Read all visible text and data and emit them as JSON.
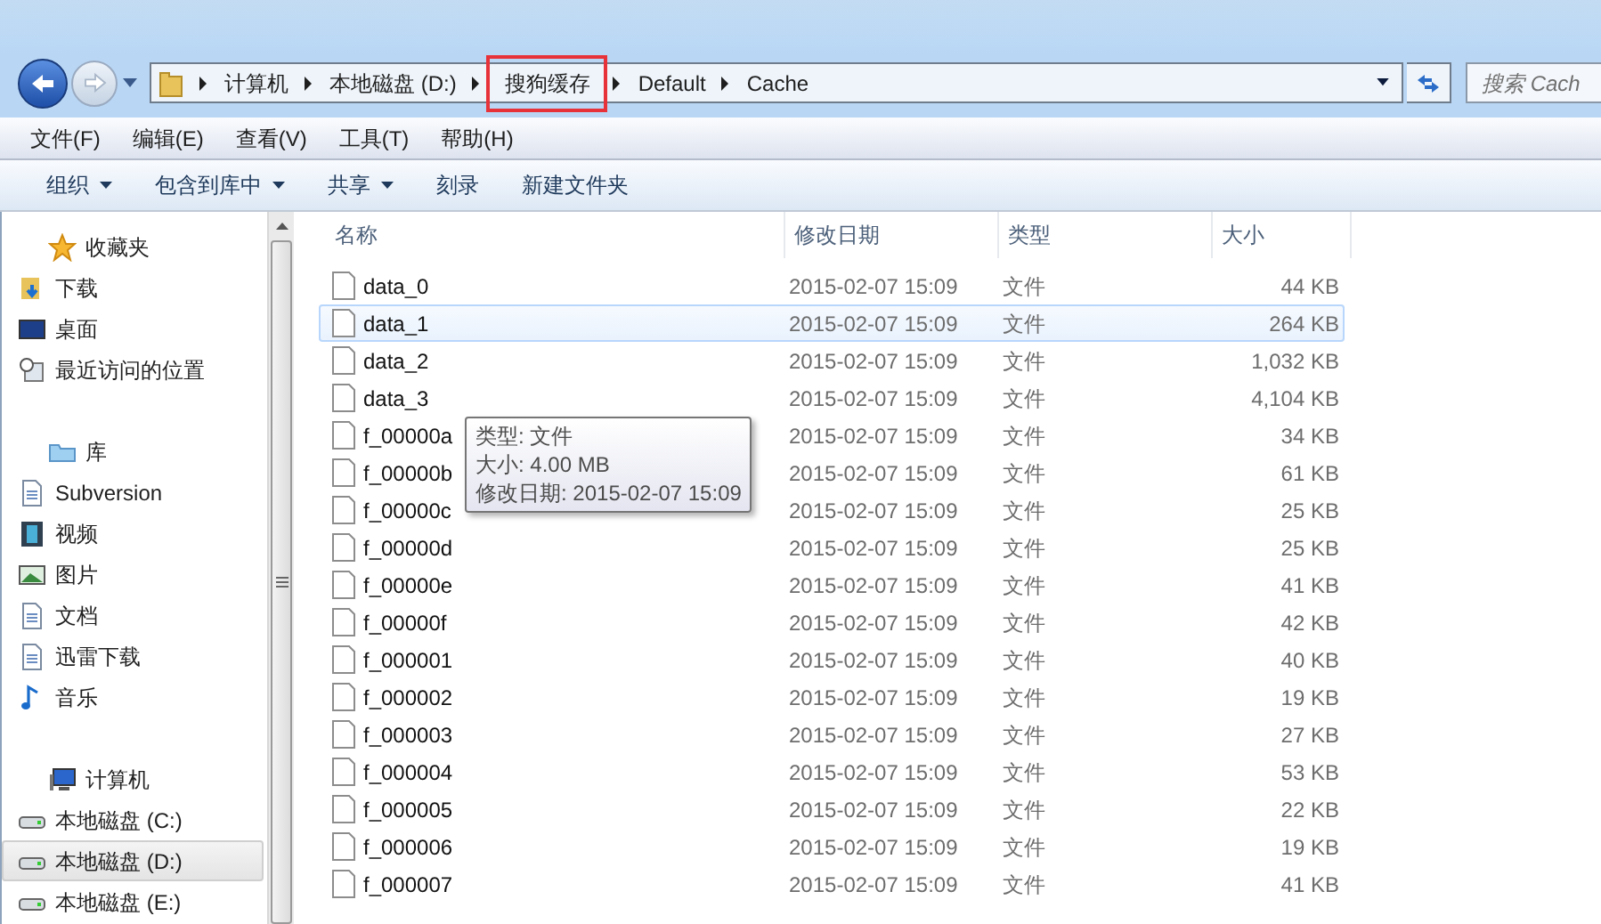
{
  "breadcrumb": [
    {
      "label": "计算机",
      "highlighted": false
    },
    {
      "label": "本地磁盘 (D:)",
      "highlighted": false
    },
    {
      "label": "搜狗缓存",
      "highlighted": true
    },
    {
      "label": "Default",
      "highlighted": false
    },
    {
      "label": "Cache",
      "highlighted": false
    }
  ],
  "search": {
    "placeholder": "搜索 Cach"
  },
  "menu": [
    "文件(F)",
    "编辑(E)",
    "查看(V)",
    "工具(T)",
    "帮助(H)"
  ],
  "toolbar": [
    {
      "label": "组织",
      "dropdown": true
    },
    {
      "label": "包含到库中",
      "dropdown": true
    },
    {
      "label": "共享",
      "dropdown": true
    },
    {
      "label": "刻录",
      "dropdown": false
    },
    {
      "label": "新建文件夹",
      "dropdown": false
    }
  ],
  "sidebar": [
    {
      "label": "收藏夹",
      "kind": "star",
      "children": [
        {
          "label": "下载",
          "kind": "download",
          "selected": false
        },
        {
          "label": "桌面",
          "kind": "desktop",
          "selected": false
        },
        {
          "label": "最近访问的位置",
          "kind": "recent",
          "selected": false
        }
      ]
    },
    {
      "label": "库",
      "kind": "library",
      "children": [
        {
          "label": "Subversion",
          "kind": "doc",
          "selected": false
        },
        {
          "label": "视频",
          "kind": "video",
          "selected": false
        },
        {
          "label": "图片",
          "kind": "picture",
          "selected": false
        },
        {
          "label": "文档",
          "kind": "doc",
          "selected": false
        },
        {
          "label": "迅雷下载",
          "kind": "doc",
          "selected": false
        },
        {
          "label": "音乐",
          "kind": "music",
          "selected": false
        }
      ]
    },
    {
      "label": "计算机",
      "kind": "computer",
      "children": [
        {
          "label": "本地磁盘 (C:)",
          "kind": "drive",
          "selected": false
        },
        {
          "label": "本地磁盘 (D:)",
          "kind": "drive",
          "selected": true
        },
        {
          "label": "本地磁盘 (E:)",
          "kind": "drive",
          "selected": false
        }
      ]
    }
  ],
  "table": {
    "columns": [
      "名称",
      "修改日期",
      "类型",
      "大小"
    ],
    "rows": [
      {
        "name": "data_0",
        "date": "2015-02-07 15:09",
        "type": "文件",
        "size": "44 KB",
        "selected": false
      },
      {
        "name": "data_1",
        "date": "2015-02-07 15:09",
        "type": "文件",
        "size": "264 KB",
        "selected": true
      },
      {
        "name": "data_2",
        "date": "2015-02-07 15:09",
        "type": "文件",
        "size": "1,032 KB",
        "selected": false
      },
      {
        "name": "data_3",
        "date": "2015-02-07 15:09",
        "type": "文件",
        "size": "4,104 KB",
        "selected": false
      },
      {
        "name": "f_00000a",
        "date": "2015-02-07 15:09",
        "type": "文件",
        "size": "34 KB",
        "selected": false
      },
      {
        "name": "f_00000b",
        "date": "2015-02-07 15:09",
        "type": "文件",
        "size": "61 KB",
        "selected": false
      },
      {
        "name": "f_00000c",
        "date": "2015-02-07 15:09",
        "type": "文件",
        "size": "25 KB",
        "selected": false
      },
      {
        "name": "f_00000d",
        "date": "2015-02-07 15:09",
        "type": "文件",
        "size": "25 KB",
        "selected": false
      },
      {
        "name": "f_00000e",
        "date": "2015-02-07 15:09",
        "type": "文件",
        "size": "41 KB",
        "selected": false
      },
      {
        "name": "f_00000f",
        "date": "2015-02-07 15:09",
        "type": "文件",
        "size": "42 KB",
        "selected": false
      },
      {
        "name": "f_000001",
        "date": "2015-02-07 15:09",
        "type": "文件",
        "size": "40 KB",
        "selected": false
      },
      {
        "name": "f_000002",
        "date": "2015-02-07 15:09",
        "type": "文件",
        "size": "19 KB",
        "selected": false
      },
      {
        "name": "f_000003",
        "date": "2015-02-07 15:09",
        "type": "文件",
        "size": "27 KB",
        "selected": false
      },
      {
        "name": "f_000004",
        "date": "2015-02-07 15:09",
        "type": "文件",
        "size": "53 KB",
        "selected": false
      },
      {
        "name": "f_000005",
        "date": "2015-02-07 15:09",
        "type": "文件",
        "size": "22 KB",
        "selected": false
      },
      {
        "name": "f_000006",
        "date": "2015-02-07 15:09",
        "type": "文件",
        "size": "19 KB",
        "selected": false
      },
      {
        "name": "f_000007",
        "date": "2015-02-07 15:09",
        "type": "文件",
        "size": "41 KB",
        "selected": false
      }
    ]
  },
  "tooltip": [
    "类型: 文件",
    "大小: 4.00 MB",
    "修改日期: 2015-02-07 15:09"
  ]
}
